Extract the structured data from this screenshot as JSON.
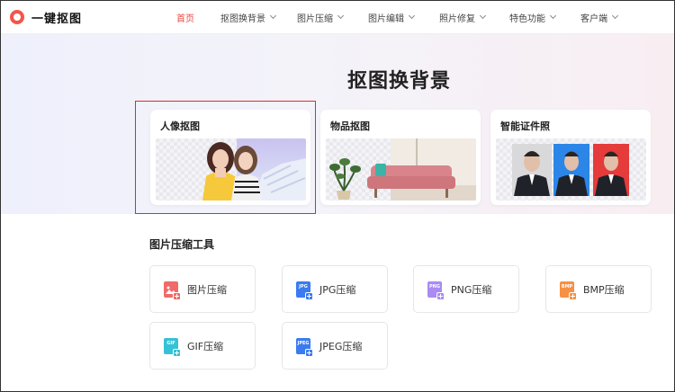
{
  "header": {
    "logo_text": "一键抠图",
    "nav": [
      {
        "label": "首页",
        "active": true,
        "dropdown": false
      },
      {
        "label": "抠图换背景",
        "active": false,
        "dropdown": true
      },
      {
        "label": "图片压缩",
        "active": false,
        "dropdown": true
      },
      {
        "label": "图片编辑",
        "active": false,
        "dropdown": true
      },
      {
        "label": "照片修复",
        "active": false,
        "dropdown": true
      },
      {
        "label": "特色功能",
        "active": false,
        "dropdown": true
      },
      {
        "label": "客户端",
        "active": false,
        "dropdown": true
      }
    ]
  },
  "hero": {
    "title": "抠图换背景",
    "cards": [
      {
        "title": "人像抠图",
        "selected": true
      },
      {
        "title": "物品抠图",
        "selected": false
      },
      {
        "title": "智能证件照",
        "selected": false
      }
    ]
  },
  "compress": {
    "title": "图片压缩工具",
    "tools": [
      {
        "label": "图片压缩",
        "icon": "image-icon",
        "tag": "",
        "color": "#f06a6a"
      },
      {
        "label": "JPG压缩",
        "icon": "jpg-file-icon",
        "tag": "JPG",
        "color": "#3a7bf0"
      },
      {
        "label": "PNG压缩",
        "icon": "png-file-icon",
        "tag": "PNG",
        "color": "#a98bf2"
      },
      {
        "label": "BMP压缩",
        "icon": "bmp-file-icon",
        "tag": "BMP",
        "color": "#f59145"
      },
      {
        "label": "GIF压缩",
        "icon": "gif-file-icon",
        "tag": "GIF",
        "color": "#35c1d6"
      },
      {
        "label": "JPEG压缩",
        "icon": "jpeg-file-icon",
        "tag": "JPEG",
        "color": "#3a7bf0"
      }
    ]
  },
  "colors": {
    "accent": "#e5493f",
    "selection_border": "#e0292d"
  }
}
